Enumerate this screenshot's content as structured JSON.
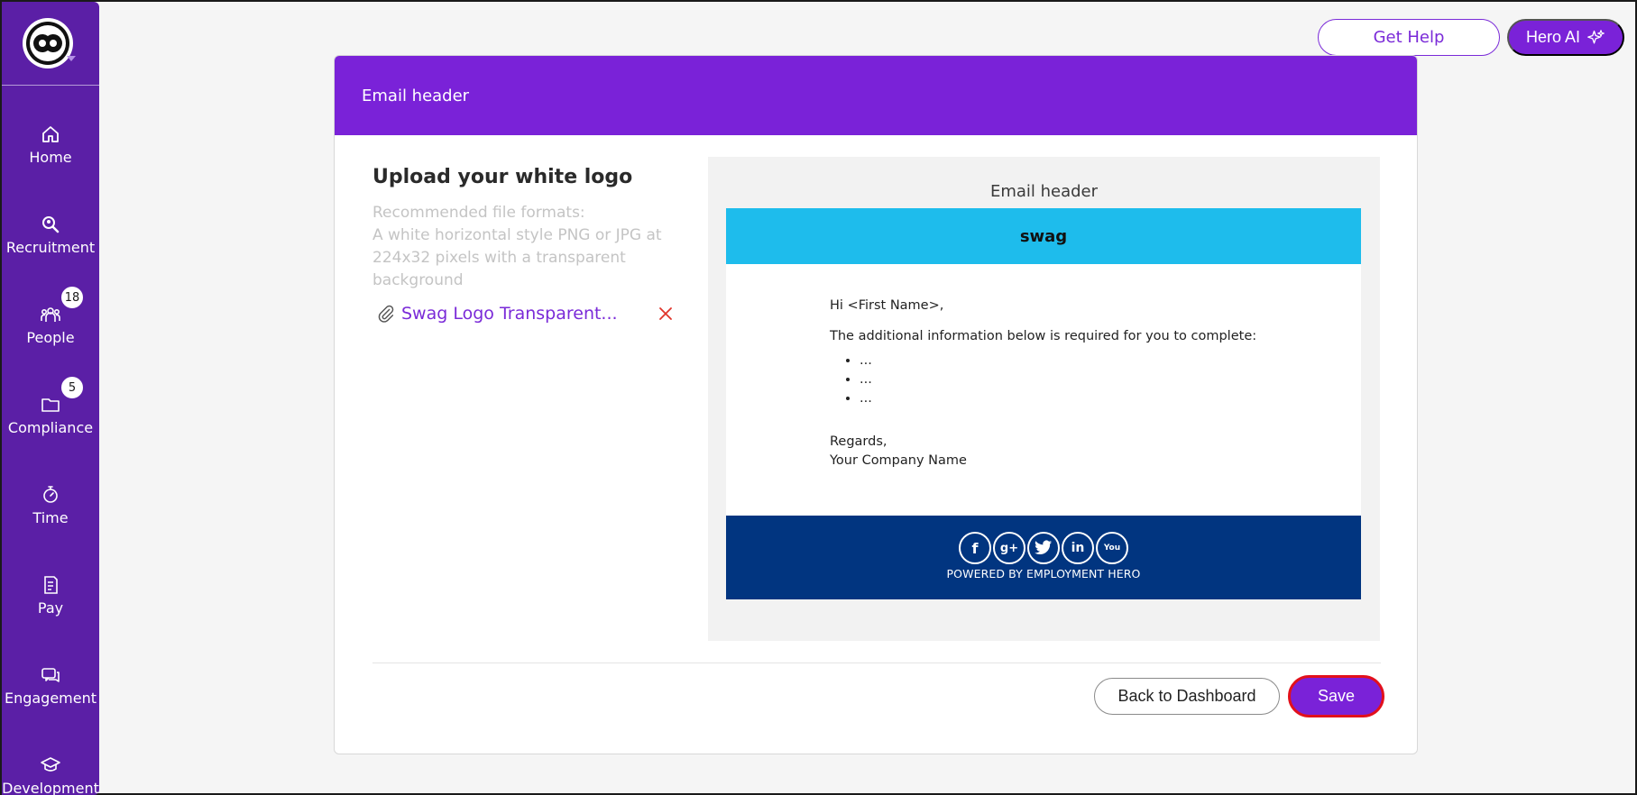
{
  "nav": {
    "items": [
      {
        "label": "Home",
        "icon": "home-icon"
      },
      {
        "label": "Recruitment",
        "icon": "recruitment-icon"
      },
      {
        "label": "People",
        "icon": "people-icon",
        "badge": "18"
      },
      {
        "label": "Compliance",
        "icon": "folder-icon",
        "badge": "5"
      },
      {
        "label": "Time",
        "icon": "stopwatch-icon"
      },
      {
        "label": "Pay",
        "icon": "payslip-icon"
      },
      {
        "label": "Engagement",
        "icon": "chat-icon"
      },
      {
        "label": "Development",
        "icon": "graduation-cap-icon"
      }
    ]
  },
  "topbar": {
    "help_label": "Get Help",
    "hero_label": "Hero AI"
  },
  "card": {
    "header_title": "Email header",
    "upload_title": "Upload your white logo",
    "upload_desc_line1": "Recommended file formats:",
    "upload_desc_line2": "A white horizontal style PNG or JPG at 224x32 pixels with a transparent background",
    "file_name": "Swag Logo Transparent...",
    "preview": {
      "title": "Email header",
      "brand": "swag",
      "greeting": "Hi <First Name>,",
      "intro": "The additional information below is required for you to complete:",
      "bullets": [
        "...",
        "...",
        "..."
      ],
      "regards": "Regards,",
      "company": "Your Company Name",
      "powered": "POWERED BY EMPLOYMENT HERO",
      "socials": [
        "f",
        "g+",
        "t",
        "in",
        "You"
      ]
    },
    "back_label": "Back to Dashboard",
    "save_label": "Save"
  },
  "colors": {
    "sidebar": "#5b1fa6",
    "accent": "#7a22d8",
    "banner": "#1ebcec",
    "footer": "#013580",
    "save_outline": "#e2101c"
  }
}
